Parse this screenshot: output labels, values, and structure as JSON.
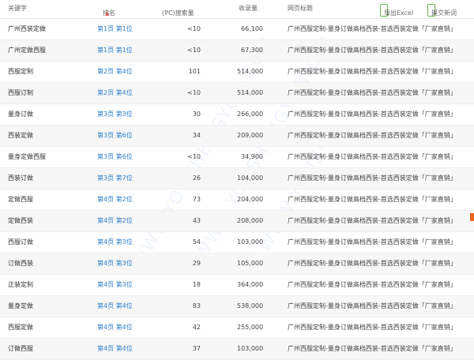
{
  "header": {
    "keyword": "关键字",
    "rank": "排名",
    "rank_sort_icon": "▲",
    "pc_search": "(PC)搜索量",
    "pc_sort_icon": "⇕",
    "indexed": "收录量",
    "page_title": "网页标题",
    "export_label": "导出Excel",
    "submit_label": "提交新词"
  },
  "rows": [
    {
      "keyword": "广州西装定做",
      "rank": "第1页 第1位",
      "pc": "<10",
      "indexed": "66,100",
      "title": "广州西服定制-量身订做高档西装-首选西装定做「厂家直销」"
    },
    {
      "keyword": "广州定做西服",
      "rank": "第1页 第1位",
      "pc": "<10",
      "indexed": "67,300",
      "title": "广州西服定制-量身订做高档西装-首选西装定做「厂家直销」"
    },
    {
      "keyword": "西服定制",
      "rank": "第2页 第4位",
      "pc": "101",
      "indexed": "514,000",
      "title": "广州西服定制-量身订做高档西装-首选西装定做「厂家直销」"
    },
    {
      "keyword": "西服订制",
      "rank": "第2页 第4位",
      "pc": "<10",
      "indexed": "514,000",
      "title": "广州西服定制-量身订做高档西装-首选西装定做「厂家直销」"
    },
    {
      "keyword": "量身订做",
      "rank": "第3页 第3位",
      "pc": "30",
      "indexed": "266,000",
      "title": "广州西服定制-量身订做高档西装-首选西装定做「厂家直销」"
    },
    {
      "keyword": "西装定做",
      "rank": "第3页 第6位",
      "pc": "34",
      "indexed": "209,000",
      "title": "广州西服定制-量身订做高档西装-首选西装定做「厂家直销」"
    },
    {
      "keyword": "量身定做西服",
      "rank": "第3页 第6位",
      "pc": "<10",
      "indexed": "34,900",
      "title": "广州西服定制-量身订做高档西装-首选西装定做「厂家直销」"
    },
    {
      "keyword": "西装订做",
      "rank": "第3页 第7位",
      "pc": "26",
      "indexed": "104,000",
      "title": "广州西服定制-量身订做高档西装-首选西装定做「厂家直销」"
    },
    {
      "keyword": "定做西服",
      "rank": "第4页 第2位",
      "pc": "73",
      "indexed": "204,000",
      "title": "广州西服定制-量身订做高档西装-首选西装定做「厂家直销」"
    },
    {
      "keyword": "定做西装",
      "rank": "第4页 第2位",
      "pc": "43",
      "indexed": "208,000",
      "title": "广州西服定制-量身订做高档西装-首选西装定做「厂家直销」"
    },
    {
      "keyword": "西服订做",
      "rank": "第4页 第3位",
      "pc": "54",
      "indexed": "103,000",
      "title": "广州西服定制-量身订做高档西装-首选西装定做「厂家直销」"
    },
    {
      "keyword": "订做西装",
      "rank": "第4页 第3位",
      "pc": "29",
      "indexed": "105,000",
      "title": "广州西服定制-量身订做高档西装-首选西装定做「厂家直销」"
    },
    {
      "keyword": "正装定制",
      "rank": "第4页 第3位",
      "pc": "18",
      "indexed": "364,000",
      "title": "广州西服定制-量身订做高档西装-首选西装定做「厂家直销」"
    },
    {
      "keyword": "量身定做",
      "rank": "第4页 第4位",
      "pc": "83",
      "indexed": "538,000",
      "title": "广州西服定制-量身订做高档西装-首选西装定做「厂家直销」"
    },
    {
      "keyword": "西服定做",
      "rank": "第4页 第4位",
      "pc": "42",
      "indexed": "255,000",
      "title": "广州西服定制-量身订做高档西装-首选西装定做「厂家直销」"
    },
    {
      "keyword": "订做西服",
      "rank": "第4页 第4位",
      "pc": "37",
      "indexed": "103,000",
      "title": "广州西服定制-量身订做高档西装-首选西装定做「厂家直销」"
    }
  ],
  "watermark": [
    "WWW.YOUSHENGYUN.COM",
    "WWW.YOUSHENGYUN.COM",
    "WWW.YOUSHENGYUN.COM"
  ],
  "colors": {
    "link": "#2a7dc9",
    "accent_green": "#6ab04c",
    "side_tab": "#e8661c"
  }
}
